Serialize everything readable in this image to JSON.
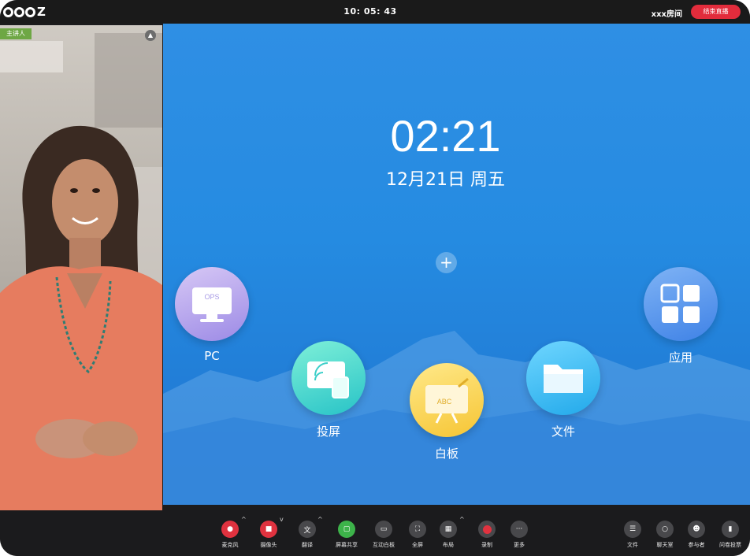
{
  "topbar": {
    "clock": "10: 05: 43",
    "room_name": "xxx房间",
    "end_button": "结束直播"
  },
  "video": {
    "presenter_tag": "主讲人"
  },
  "desktop": {
    "time": "02:21",
    "date": "12月21日 周五",
    "add": "+",
    "apps": {
      "pc": {
        "label": "PC",
        "badge": "OPS"
      },
      "cast": {
        "label": "投屏"
      },
      "whiteboard": {
        "label": "白板",
        "badge": "ABC"
      },
      "files": {
        "label": "文件"
      },
      "apps": {
        "label": "应用"
      }
    }
  },
  "toolbar": {
    "mic": "麦克风",
    "camera": "摄像头",
    "translate": "翻译",
    "screen_share": "屏幕共享",
    "interactive_whiteboard": "互动白板",
    "fullscreen": "全屏",
    "layout": "布局",
    "record": "录制",
    "more": "更多",
    "files": "文件",
    "chat": "聊天室",
    "participants": "参与者",
    "survey": "问卷投票"
  },
  "colors": {
    "end_button": "#e22c3c",
    "presenter_tag": "#6ea744",
    "desktop_blue": "#258be1",
    "mic_red": "#e0323f",
    "share_green": "#3db34a"
  }
}
